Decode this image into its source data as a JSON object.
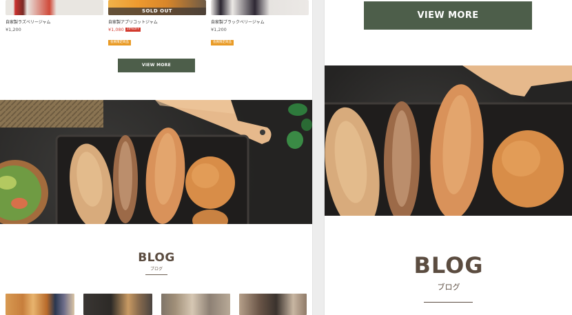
{
  "products": [
    {
      "name": "自家製ラズベリージャム",
      "price": "¥1,200",
      "sold_out": "",
      "sale": false,
      "off": "",
      "badge": ""
    },
    {
      "name": "自家製アプリコットジャム",
      "price": "¥1,080",
      "sold_out": "SOLD OUT",
      "sale": true,
      "off": "10%OFF",
      "badge": "会員限定商品"
    },
    {
      "name": "自家製ブラックベリージャム",
      "price": "¥1,200",
      "sold_out": "",
      "sale": false,
      "off": "",
      "badge": "会員限定商品"
    }
  ],
  "view_more_label": "VIEW MORE",
  "blog": {
    "title": "BLOG",
    "subtitle": "ブログ"
  },
  "colors": {
    "accent": "#4d5e4a",
    "heading": "#5b4c40",
    "sale": "#d23b2f",
    "badge": "#e99b26"
  }
}
